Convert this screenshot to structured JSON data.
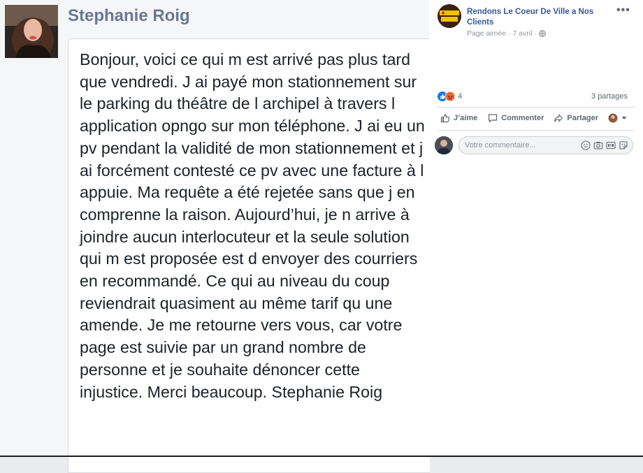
{
  "post": {
    "author": "Stephanie Roig",
    "body": "Bonjour, voici ce qui m est arrivé pas plus tard que vendredi. J ai payé mon stationnement sur le parking du théâtre de l archipel à travers l application opngo sur mon téléphone. J ai eu un pv pendant la validité de mon stationnement et j ai forcément contesté ce pv avec une facture à l appuie. Ma requête a été rejetée sans que j en comprenne la raison. Aujourd’hui, je n arrive à joindre aucun interlocuteur et la seule solution qui m est proposée est d envoyer des courriers en recommandé. Ce qui au niveau du coup reviendrait quasiment au même tarif qu une amende. Je me retourne vers vous, car votre page est suivie par un grand nombre de personne et je souhaite dénoncer cette injustice. Merci beaucoup. Stephanie Roig"
  },
  "fb_post": {
    "page_name": "Rendons Le Coeur De Ville a Nos Clients",
    "meta_liked": "Page aimée",
    "meta_separator": "·",
    "meta_date": "7 avril",
    "meta_separator2": "·",
    "reaction_count": "4",
    "shares": "3 partages",
    "actions": {
      "like": "J’aime",
      "comment": "Commenter",
      "share": "Partager"
    },
    "comment_placeholder": "Votre commentaire..."
  },
  "colors": {
    "link": "#365899",
    "author": "#6b7695",
    "like_blue": "#1877f2",
    "angry_orange": "#f0672a"
  },
  "icons": [
    "more-dots-icon",
    "globe-icon",
    "like-reaction-icon",
    "angry-reaction-icon",
    "like-icon",
    "comment-icon",
    "share-icon",
    "emoji-icon",
    "camera-icon",
    "gif-icon",
    "sticker-icon"
  ]
}
